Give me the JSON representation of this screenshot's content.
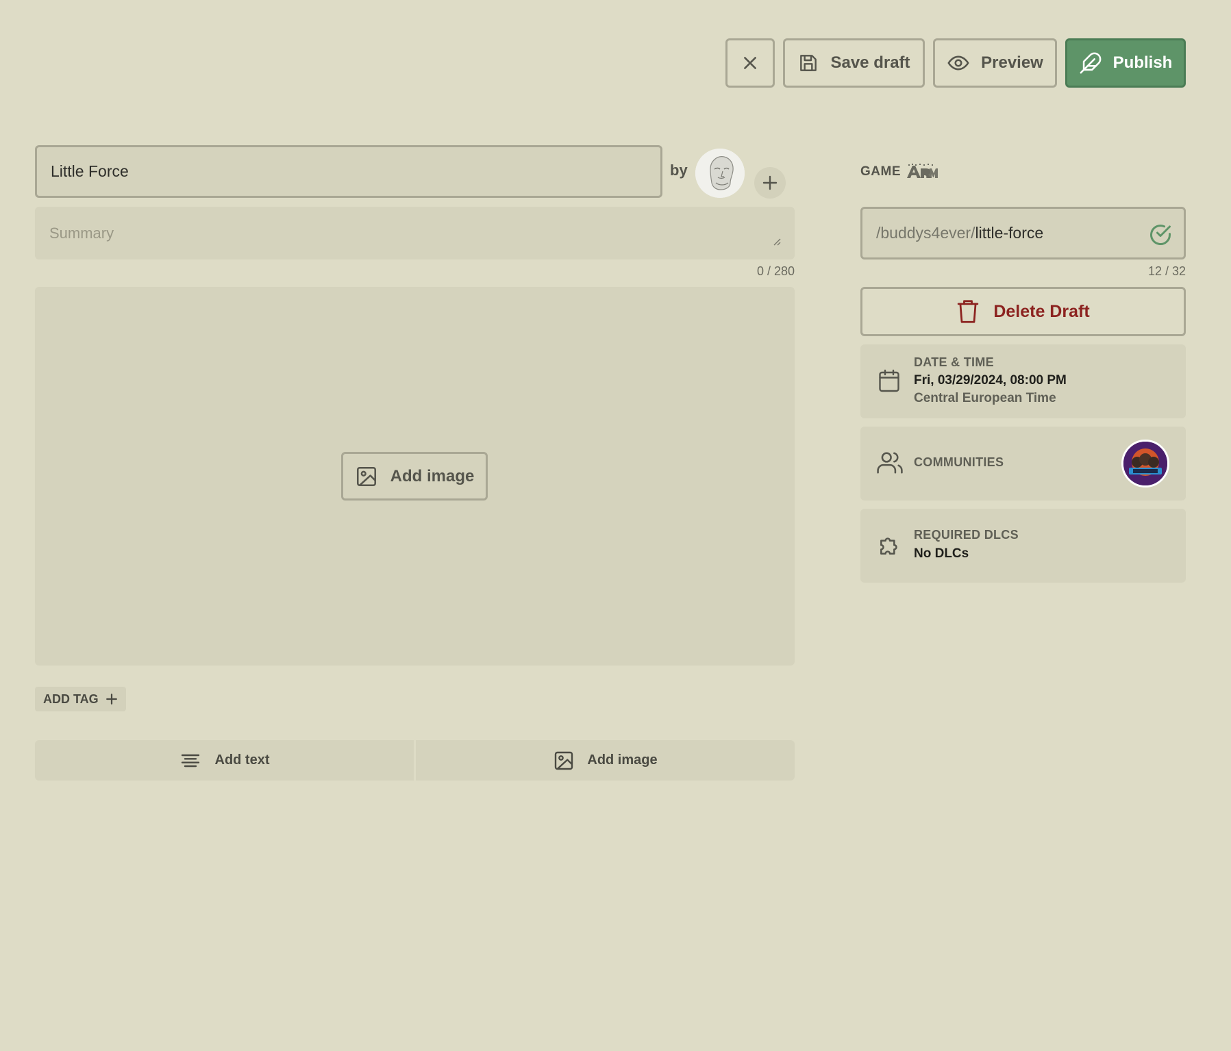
{
  "toolbar": {
    "close_icon": "close-icon",
    "save_draft": "Save draft",
    "preview": "Preview",
    "publish": "Publish",
    "publish_color": "#5e9468"
  },
  "editor": {
    "title_value": "Little Force",
    "by_label": "by",
    "summary_placeholder": "Summary",
    "summary_counter": "0 / 280",
    "add_image_label": "Add image",
    "add_tag_label": "ADD TAG",
    "add_text_block": "Add text",
    "add_image_block": "Add image"
  },
  "sidebar": {
    "game_label": "GAME",
    "slug_prefix": "/buddys4ever/",
    "slug_value": "little-force",
    "slug_counter": "12 / 32",
    "delete_draft": "Delete Draft",
    "date_time": {
      "label": "DATE & TIME",
      "value": "Fri, 03/29/2024, 08:00 PM",
      "timezone": "Central European Time"
    },
    "communities": {
      "label": "COMMUNITIES"
    },
    "required_dlcs": {
      "label": "REQUIRED DLCS",
      "value": "No DLCs"
    }
  },
  "colors": {
    "background": "#dedcc6",
    "panel": "#d5d3bd",
    "border": "#a9a794",
    "danger": "#8c2320",
    "success": "#5e9468"
  }
}
